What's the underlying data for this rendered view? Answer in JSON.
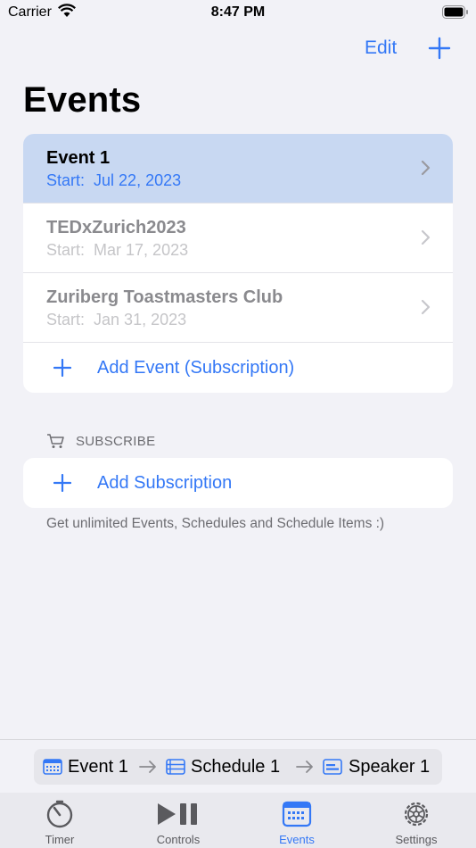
{
  "status_bar": {
    "carrier": "Carrier",
    "time": "8:47 PM"
  },
  "nav": {
    "edit_label": "Edit"
  },
  "title": "Events",
  "events": [
    {
      "name": "Event 1",
      "start_label": "Start:",
      "start_date": "Jul 22, 2023",
      "selected": true
    },
    {
      "name": "TEDxZurich2023",
      "start_label": "Start:",
      "start_date": "Mar 17, 2023",
      "selected": false
    },
    {
      "name": "Zuriberg Toastmasters Club",
      "start_label": "Start:",
      "start_date": "Jan 31, 2023",
      "selected": false
    }
  ],
  "add_event_label": "Add Event (Subscription)",
  "subscribe": {
    "header": "SUBSCRIBE",
    "add_label": "Add Subscription",
    "footer": "Get unlimited Events, Schedules and Schedule Items :)"
  },
  "breadcrumb": {
    "event": "Event 1",
    "schedule": "Schedule 1",
    "speaker": "Speaker 1"
  },
  "tabs": [
    {
      "label": "Timer",
      "icon": "timer-icon"
    },
    {
      "label": "Controls",
      "icon": "play-pause-icon"
    },
    {
      "label": "Events",
      "icon": "calendar-icon",
      "active": true
    },
    {
      "label": "Settings",
      "icon": "gear-icon"
    }
  ],
  "colors": {
    "accent": "#3478f6",
    "selected_row": "#c8d8f2",
    "background": "#f2f2f7"
  }
}
